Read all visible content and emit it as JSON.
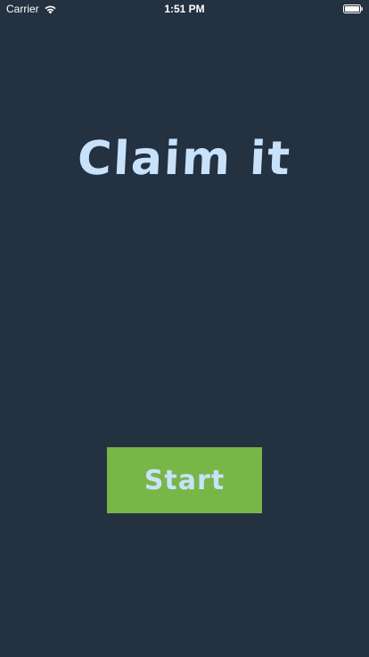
{
  "status_bar": {
    "carrier": "Carrier",
    "time": "1:51 PM",
    "wifi_icon": "wifi-icon",
    "battery_icon": "battery-icon"
  },
  "main": {
    "title": "Claim it",
    "start_label": "Start"
  },
  "colors": {
    "background": "#243141",
    "title_text": "#c8e2fb",
    "button_background": "#78b648"
  }
}
